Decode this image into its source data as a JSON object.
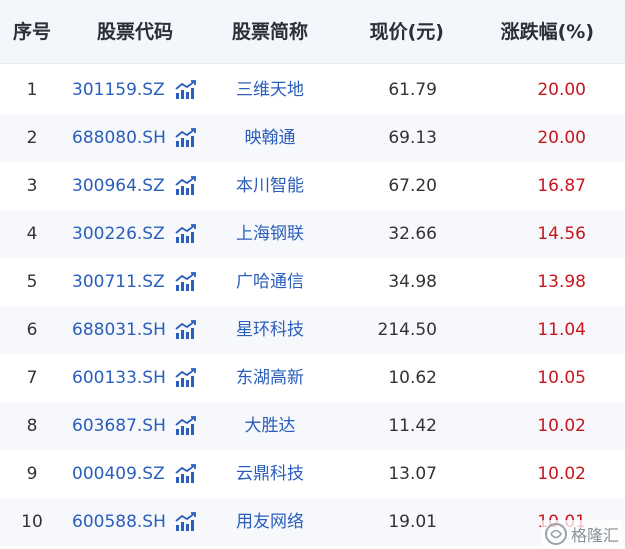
{
  "header": {
    "index": "序号",
    "code": "股票代码",
    "name": "股票简称",
    "price": "现价(元)",
    "change": "涨跌幅(%)"
  },
  "rows": [
    {
      "index": "1",
      "code": "301159.SZ",
      "name": "三维天地",
      "price": "61.79",
      "change": "20.00"
    },
    {
      "index": "2",
      "code": "688080.SH",
      "name": "映翰通",
      "price": "69.13",
      "change": "20.00"
    },
    {
      "index": "3",
      "code": "300964.SZ",
      "name": "本川智能",
      "price": "67.20",
      "change": "16.87"
    },
    {
      "index": "4",
      "code": "300226.SZ",
      "name": "上海钢联",
      "price": "32.66",
      "change": "14.56"
    },
    {
      "index": "5",
      "code": "300711.SZ",
      "name": "广哈通信",
      "price": "34.98",
      "change": "13.98"
    },
    {
      "index": "6",
      "code": "688031.SH",
      "name": "星环科技",
      "price": "214.50",
      "change": "11.04"
    },
    {
      "index": "7",
      "code": "600133.SH",
      "name": "东湖高新",
      "price": "10.62",
      "change": "10.05"
    },
    {
      "index": "8",
      "code": "603687.SH",
      "name": "大胜达",
      "price": "11.42",
      "change": "10.02"
    },
    {
      "index": "9",
      "code": "000409.SZ",
      "name": "云鼎科技",
      "price": "13.07",
      "change": "10.02"
    },
    {
      "index": "10",
      "code": "600588.SH",
      "name": "用友网络",
      "price": "19.01",
      "change": "10.01"
    }
  ],
  "row_icon": "trend-chart-icon",
  "watermark": {
    "text": "格隆汇",
    "icon": "gelonghui-logo"
  },
  "colors": {
    "header_bg": "#f3f6fa",
    "link": "#2a5ebd",
    "rise": "#c8161d",
    "alt_row_bg": "#f6f8fb"
  }
}
